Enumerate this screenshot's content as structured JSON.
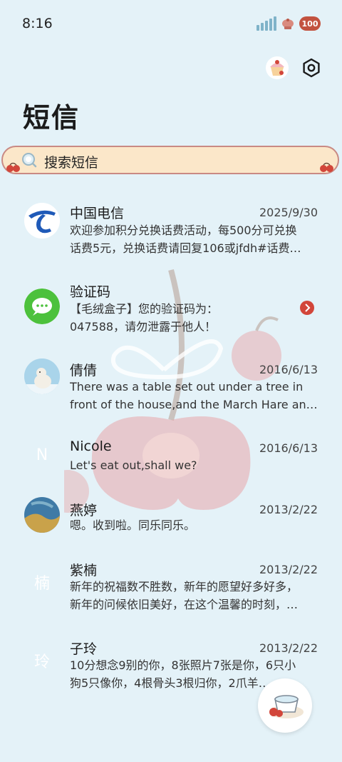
{
  "status": {
    "time": "8:16",
    "battery": "100"
  },
  "header": {
    "title": "短信"
  },
  "search": {
    "placeholder": "搜索短信"
  },
  "colors": {
    "background": "#e4f2f8",
    "search_bg": "#fbe7c9",
    "search_border": "#c98a84",
    "battery": "#c2523f"
  },
  "icons": [
    "signal-icon",
    "wifi-icon",
    "battery-icon",
    "cupcake-icon",
    "settings-icon",
    "search-icon",
    "compose-icon"
  ],
  "messages": [
    {
      "sender": "中国电信",
      "date": "2025/9/30",
      "lines": [
        "欢迎参加积分兑换话费活动，每500分可兑换",
        "话费5元，兑换话费请回复106或jfdh#话费…"
      ],
      "avatar": "telecom"
    },
    {
      "sender": "验证码",
      "date": "",
      "lines": [
        "【毛绒盒子】您的验证码为：",
        "047588，请勿泄露于他人！"
      ],
      "avatar": "sms"
    },
    {
      "sender": "倩倩",
      "date": "2016/6/13",
      "lines": [
        "There was a table set out under a tree in",
        "front of the house,and the March Hare an…"
      ],
      "avatar": "bear"
    },
    {
      "sender": "Nicole",
      "date": "2016/6/13",
      "lines": [
        "Let's eat out,shall we?"
      ],
      "avatar": "N"
    },
    {
      "sender": "燕婷",
      "date": "2013/2/22",
      "lines": [
        "嗯。收到啦。同乐同乐。"
      ],
      "avatar": "photo"
    },
    {
      "sender": "紫楠",
      "date": "2013/2/22",
      "lines": [
        "新年的祝福数不胜数，新年的愿望好多好多，",
        "新年的问候依旧美好，在这个温馨的时刻，…"
      ],
      "avatar": "楠"
    },
    {
      "sender": "子玲",
      "date": "2013/2/22",
      "lines": [
        "10分想念9别的你，8张照片7张是你，6只小",
        "狗5只像你，4根骨头3根归你，2爪羊…"
      ],
      "avatar": "玲"
    }
  ]
}
